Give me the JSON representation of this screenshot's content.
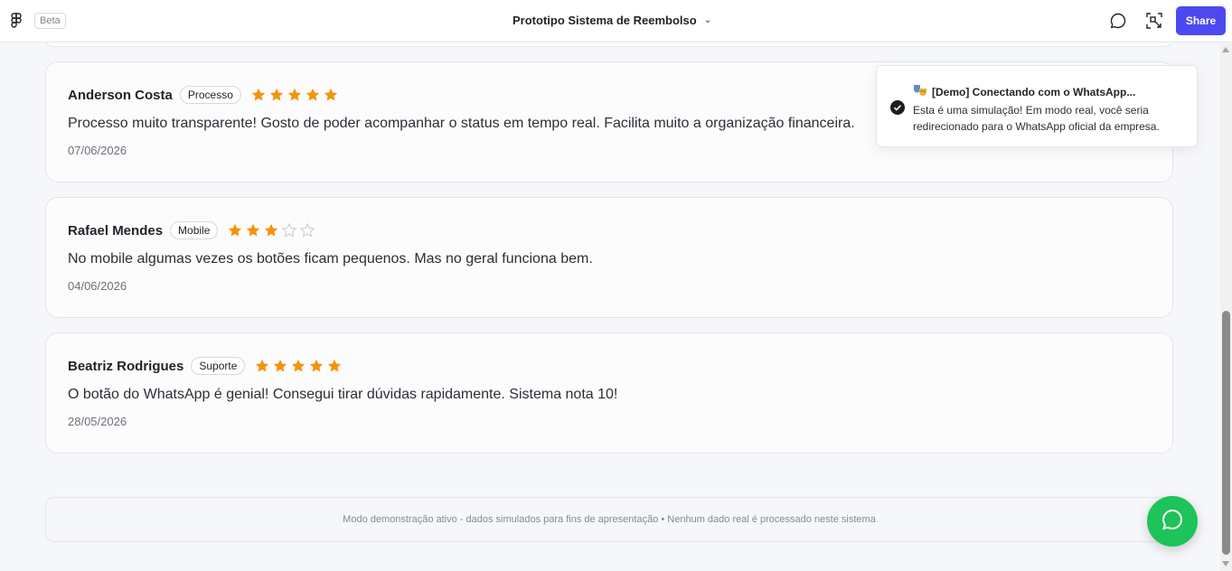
{
  "topbar": {
    "beta_label": "Beta",
    "title": "Prototipo Sistema de Reembolso",
    "share_label": "Share",
    "logo_icon": "figma-logo-icon",
    "comment_icon": "comment-icon",
    "inspect_icon": "inspect-icon",
    "accent_color": "#4d49f0"
  },
  "reviews": [
    {
      "name": "Anderson Costa",
      "tag": "Processo",
      "rating": 5,
      "max_rating": 5,
      "text": "Processo muito transparente! Gosto de poder acompanhar o status em tempo real. Facilita muito a organização financeira.",
      "date": "07/06/2026"
    },
    {
      "name": "Rafael Mendes",
      "tag": "Mobile",
      "rating": 3,
      "max_rating": 5,
      "text": "No mobile algumas vezes os botões ficam pequenos. Mas no geral funciona bem.",
      "date": "04/06/2026"
    },
    {
      "name": "Beatriz Rodrigues",
      "tag": "Suporte",
      "rating": 5,
      "max_rating": 5,
      "text": "O botão do WhatsApp é genial! Consegui tirar dúvidas rapidamente. Sistema nota 10!",
      "date": "28/05/2026"
    }
  ],
  "footer": {
    "text": "Modo demonstração ativo - dados simulados para fins de apresentação • Nenhum dado real é processado neste sistema"
  },
  "toast": {
    "title": "[Demo] Conectando com o WhatsApp...",
    "message": "Esta é uma simulação! Em modo real, você seria redirecionado para o WhatsApp oficial da empresa.",
    "title_icon": "theater-masks-icon",
    "status_icon": "check-circle-icon"
  },
  "fab": {
    "icon": "whatsapp-icon",
    "color": "#1ec35a"
  },
  "colors": {
    "star_filled": "#f5930b",
    "star_empty": "#c9ccd1"
  }
}
